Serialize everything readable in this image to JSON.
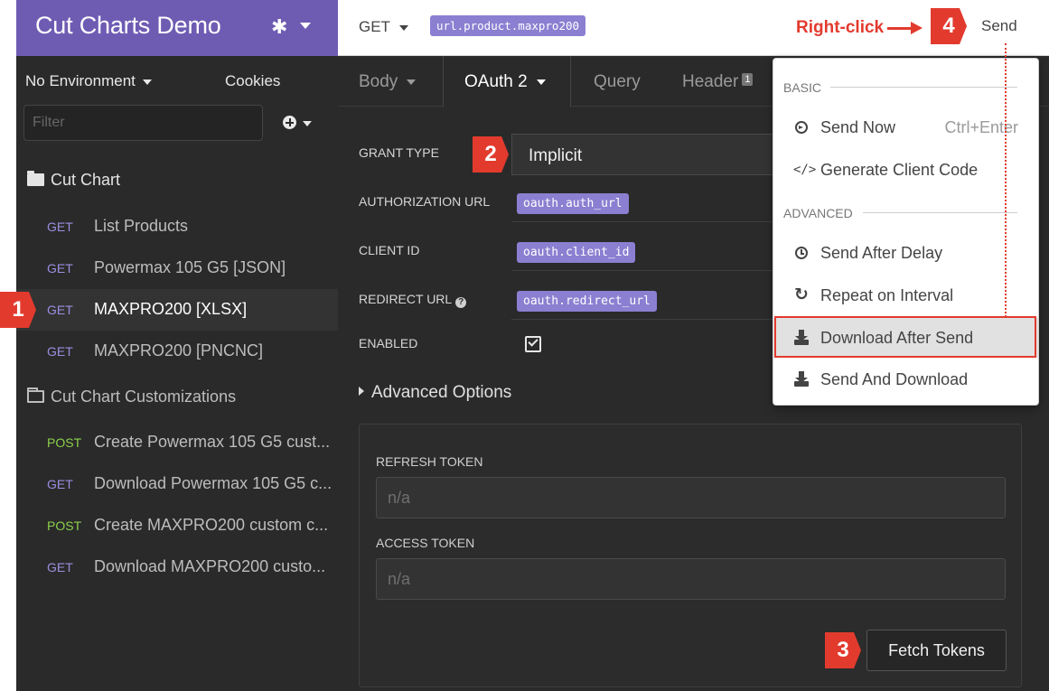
{
  "workspace": {
    "title": "Cut Charts Demo",
    "icon": "✱"
  },
  "environment": {
    "label": "No Environment",
    "cookies_label": "Cookies"
  },
  "filter": {
    "placeholder": "Filter"
  },
  "sidebar": {
    "folders": [
      {
        "name": "Cut Chart",
        "requests": [
          {
            "method": "GET",
            "name": "List Products"
          },
          {
            "method": "GET",
            "name": "Powermax 105 G5 [JSON]"
          },
          {
            "method": "GET",
            "name": "MAXPRO200 [XLSX]",
            "active": true
          },
          {
            "method": "GET",
            "name": "MAXPRO200 [PNCNC]"
          }
        ]
      },
      {
        "name": "Cut Chart Customizations",
        "requests": [
          {
            "method": "POST",
            "name": "Create Powermax 105 G5 cust..."
          },
          {
            "method": "GET",
            "name": "Download Powermax 105 G5 c..."
          },
          {
            "method": "POST",
            "name": "Create MAXPRO200 custom c..."
          },
          {
            "method": "GET",
            "name": "Download MAXPRO200 custo..."
          }
        ]
      }
    ]
  },
  "url_bar": {
    "method": "GET",
    "url_variable": "url.product.maxpro200",
    "send_label": "Send"
  },
  "tabs": [
    {
      "label": "Body"
    },
    {
      "label": "OAuth 2"
    },
    {
      "label": "Query"
    },
    {
      "label": "Header",
      "badge": "1"
    }
  ],
  "oauth": {
    "grant_type_label": "GRANT TYPE",
    "grant_type_value": "Implicit",
    "auth_url_label": "AUTHORIZATION URL",
    "auth_url_value": "oauth.auth_url",
    "client_id_label": "CLIENT ID",
    "client_id_value": "oauth.client_id",
    "redirect_url_label": "REDIRECT URL",
    "redirect_url_value": "oauth.redirect_url",
    "enabled_label": "ENABLED",
    "advanced_label": "Advanced Options",
    "refresh_token_label": "REFRESH TOKEN",
    "refresh_token_placeholder": "n/a",
    "access_token_label": "ACCESS TOKEN",
    "access_token_placeholder": "n/a",
    "fetch_label": "Fetch Tokens"
  },
  "send_menu": {
    "basic_label": "BASIC",
    "advanced_label": "ADVANCED",
    "items": [
      {
        "label": "Send Now",
        "shortcut": "Ctrl+Enter",
        "icon": "circle-arrow-icon"
      },
      {
        "label": "Generate Client Code",
        "icon": "code-icon"
      },
      {
        "label": "Send After Delay",
        "icon": "clock-icon"
      },
      {
        "label": "Repeat on Interval",
        "icon": "repeat-icon"
      },
      {
        "label": "Download After Send",
        "icon": "download-icon"
      },
      {
        "label": "Send And Download",
        "icon": "download-icon"
      }
    ]
  },
  "annotations": {
    "steps": [
      "1",
      "2",
      "3",
      "4"
    ],
    "right_click_label": "Right-click"
  },
  "colors": {
    "accent": "#6e5cb3",
    "variable_tag": "#8b7fd1",
    "annotation_red": "#e23b2e",
    "get_method": "#9b8fe0",
    "post_method": "#8cd14a"
  }
}
